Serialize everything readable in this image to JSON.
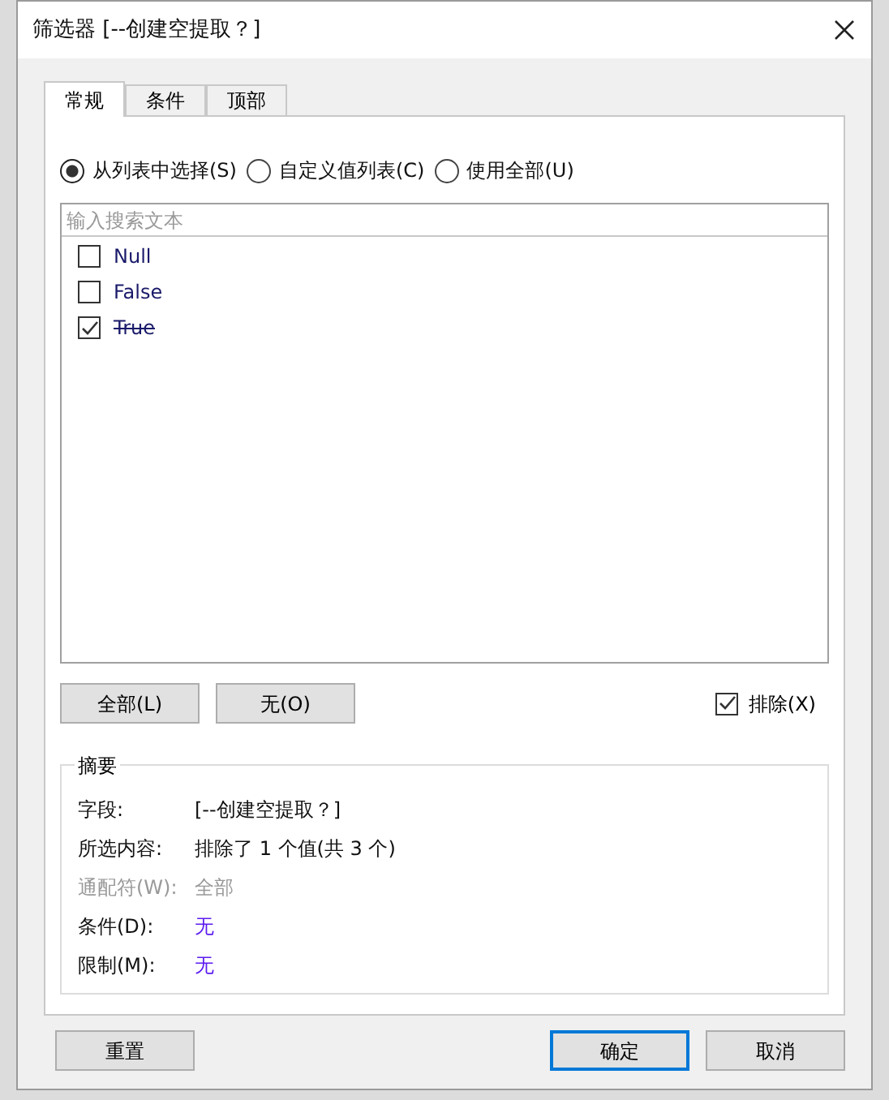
{
  "window": {
    "title": "筛选器 [--创建空提取？]"
  },
  "tabs": [
    {
      "label": "常规",
      "selected": true
    },
    {
      "label": "条件",
      "selected": false
    },
    {
      "label": "顶部",
      "selected": false
    }
  ],
  "modes": [
    {
      "label": "从列表中选择(S)",
      "selected": true
    },
    {
      "label": "自定义值列表(C)",
      "selected": false
    },
    {
      "label": "使用全部(U)",
      "selected": false
    }
  ],
  "search": {
    "placeholder": "输入搜索文本"
  },
  "values": [
    {
      "label": "Null",
      "checked": false
    },
    {
      "label": "False",
      "checked": false
    },
    {
      "label": "True",
      "checked": true
    }
  ],
  "list_buttons": [
    "全部(L)",
    "无(O)"
  ],
  "exclude": {
    "label": "排除(X)",
    "checked": true
  },
  "summary": {
    "title": "摘要",
    "rows": [
      {
        "label": "字段:",
        "value": "[--创建空提取？]",
        "kind": "plain"
      },
      {
        "label": "所选内容:",
        "value": "排除了 1 个值(共 3 个)",
        "kind": "plain"
      },
      {
        "label": "通配符(W):",
        "value": "全部",
        "kind": "disabled"
      },
      {
        "label": "条件(D):",
        "value": "无",
        "kind": "link"
      },
      {
        "label": "限制(M):",
        "value": "无",
        "kind": "link"
      }
    ]
  },
  "footer": {
    "reset": "重置",
    "ok": "确定",
    "cancel": "取消"
  }
}
